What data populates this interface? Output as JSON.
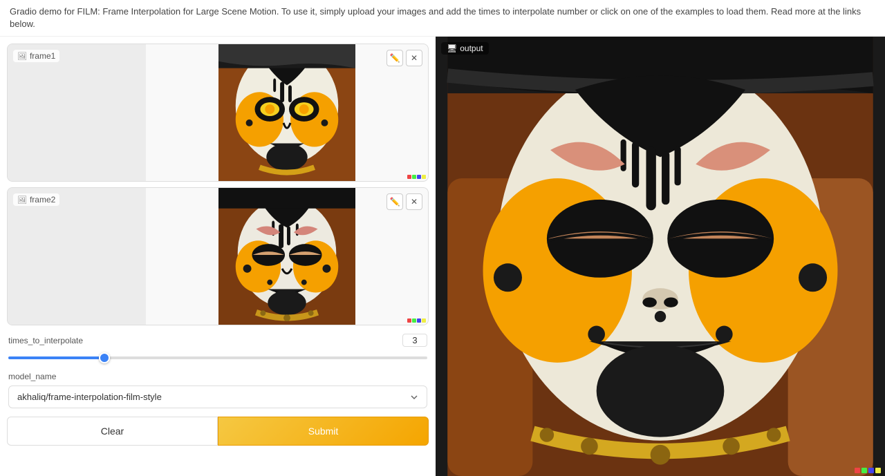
{
  "header": {
    "description": "Gradio demo for FILM: Frame Interpolation for Large Scene Motion. To use it, simply upload your images and add the times to interpolate number or click on one of the examples to load them. Read more at the links below."
  },
  "left": {
    "frame1": {
      "label": "frame1",
      "edit_btn_title": "Edit",
      "clear_btn_title": "Clear"
    },
    "frame2": {
      "label": "frame2",
      "edit_btn_title": "Edit",
      "clear_btn_title": "Clear"
    },
    "slider": {
      "label": "times_to_interpolate",
      "value": 3,
      "min": 1,
      "max": 10,
      "percent": 52
    },
    "dropdown": {
      "label": "model_name",
      "value": "akhaliq/frame-interpolation-film-style",
      "options": [
        "akhaliq/frame-interpolation-film-style"
      ]
    },
    "clear_btn": "Clear",
    "submit_btn": "Submit"
  },
  "right": {
    "label": "output"
  }
}
